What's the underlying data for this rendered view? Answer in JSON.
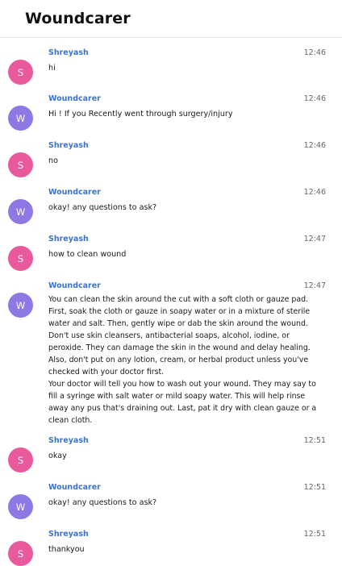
{
  "app": {
    "title": "Woundcarer"
  },
  "messages": [
    {
      "initial": "S",
      "sender": "Shreyash",
      "time": "12:46",
      "text": "hi"
    },
    {
      "initial": "W",
      "sender": "Woundcarer",
      "time": "12:46",
      "text": "Hi ! If you Recently went through surgery/injury"
    },
    {
      "initial": "S",
      "sender": "Shreyash",
      "time": "12:46",
      "text": "no"
    },
    {
      "initial": "W",
      "sender": "Woundcarer",
      "time": "12:46",
      "text": "okay! any questions to ask?"
    },
    {
      "initial": "S",
      "sender": "Shreyash",
      "time": "12:47",
      "text": "how to clean wound"
    },
    {
      "initial": "W",
      "sender": "Woundcarer",
      "time": "12:47",
      "text": "You can clean the skin around the cut with a soft cloth or gauze pad.\nFirst, soak the cloth or gauze in soapy water or in a mixture of sterile\nwater and salt. Then, gently wipe or dab the skin around the wound.\nDon't use skin cleansers, antibacterial soaps, alcohol, iodine, or\nperoxide. They can damage the skin in the wound and delay healing.\nAlso, don't put on any lotion, cream, or herbal product unless you've\nchecked with your doctor first.\nYour doctor will tell you how to wash out your wound. They may say to\nfill a syringe with salt water or mild soapy water. This will help rinse\naway any pus that's draining out. Last, pat it dry with clean gauze or a\nclean cloth."
    },
    {
      "initial": "S",
      "sender": "Shreyash",
      "time": "12:51",
      "text": "okay"
    },
    {
      "initial": "W",
      "sender": "Woundcarer",
      "time": "12:51",
      "text": "okay! any questions to ask?"
    },
    {
      "initial": "S",
      "sender": "Shreyash",
      "time": "12:51",
      "text": "thankyou"
    }
  ],
  "colors": {
    "user_avatar": "#e85a9b",
    "bot_avatar": "#8e79e4",
    "sender_name": "#3a73c8"
  }
}
